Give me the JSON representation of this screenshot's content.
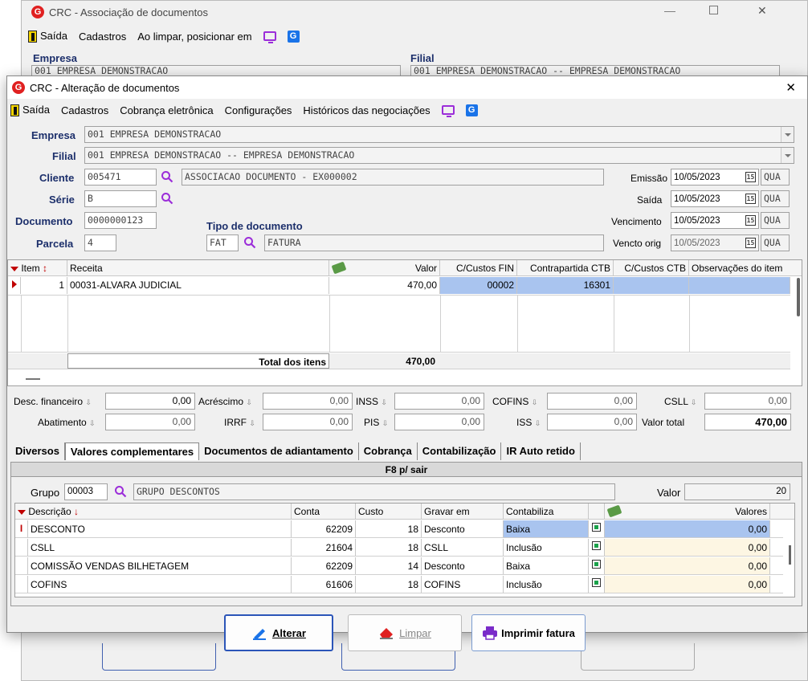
{
  "bg_window": {
    "title": "CRC - Associação de documentos",
    "menu": {
      "exit": "Saída",
      "cadastros": "Cadastros",
      "posicionar": "Ao limpar, posicionar em"
    },
    "empresa_label": "Empresa",
    "filial_label": "Filial",
    "empresa_value": "001 EMPRESA DEMONSTRACAO",
    "filial_value": "001 EMPRESA DEMONSTRACAO -- EMPRESA DEMONSTRACAO"
  },
  "window": {
    "title": "CRC - Alteração de documentos",
    "close": "✕",
    "menu": {
      "exit": "Saída",
      "cadastros": "Cadastros",
      "cobranca": "Cobrança eletrônica",
      "config": "Configurações",
      "historicos": "Históricos das negociações"
    }
  },
  "form": {
    "empresa_label": "Empresa",
    "empresa_value": "001 EMPRESA DEMONSTRACAO",
    "filial_label": "Filial",
    "filial_value": "001 EMPRESA DEMONSTRACAO -- EMPRESA DEMONSTRACAO",
    "cliente_label": "Cliente",
    "cliente_code": "005471",
    "cliente_name": "ASSOCIACAO DOCUMENTO - EX000002",
    "serie_label": "Série",
    "serie_value": "B",
    "documento_label": "Documento",
    "documento_value": "0000000123",
    "parcela_label": "Parcela",
    "parcela_value": "4",
    "tipo_label": "Tipo de documento",
    "tipo_code": "FAT",
    "tipo_name": "FATURA"
  },
  "dates": {
    "emissao_label": "Emissão",
    "emissao": "10/05/2023",
    "emissao_day": "QUA",
    "saida_label": "Saída",
    "saida": "10/05/2023",
    "saida_day": "QUA",
    "venc_label": "Vencimento",
    "venc": "10/05/2023",
    "venc_day": "QUA",
    "vencorig_label": "Vencto orig",
    "vencorig": "10/05/2023",
    "vencorig_day": "QUA",
    "cal_glyph": "15"
  },
  "items_grid": {
    "headers": {
      "item": "Item",
      "receita": "Receita",
      "valor": "Valor",
      "ccfin": "C/Custos FIN",
      "contra": "Contrapartida CTB",
      "ccctb": "C/Custos CTB",
      "obs": "Observações do item"
    },
    "rows": [
      {
        "item": "1",
        "receita": "00031-ALVARA JUDICIAL",
        "valor": "470,00",
        "ccfin": "00002",
        "contra": "16301",
        "ccctb": "",
        "obs": ""
      }
    ],
    "total_label": "Total dos itens",
    "total_value": "470,00"
  },
  "totals": {
    "desc_label": "Desc. financeiro",
    "desc": "0,00",
    "acres_label": "Acréscimo",
    "acres": "0,00",
    "inss_label": "INSS",
    "inss": "0,00",
    "cofins_label": "COFINS",
    "cofins": "0,00",
    "csll_label": "CSLL",
    "csll": "0,00",
    "abat_label": "Abatimento",
    "abat": "0,00",
    "irrf_label": "IRRF",
    "irrf": "0,00",
    "pis_label": "PIS",
    "pis": "0,00",
    "iss_label": "ISS",
    "iss": "0,00",
    "valortotal_label": "Valor total",
    "valortotal": "470,00"
  },
  "tabs": [
    "Diversos",
    "Valores complementares",
    "Documentos de adiantamento",
    "Cobrança",
    "Contabilização",
    "IR Auto retido"
  ],
  "complementares": {
    "banner": "F8 p/ sair",
    "grupo_label": "Grupo",
    "grupo_code": "00003",
    "grupo_name": "GRUPO DESCONTOS",
    "valor_label": "Valor",
    "valor": "20",
    "headers": {
      "descricao": "Descrição",
      "conta": "Conta",
      "custo": "Custo",
      "gravar": "Gravar em",
      "contabiliza": "Contabiliza",
      "valores": "Valores"
    },
    "rows": [
      {
        "descricao": "DESCONTO",
        "conta": "62209",
        "custo": "18",
        "gravar": "Desconto",
        "contabiliza": "Baixa",
        "valores": "0,00"
      },
      {
        "descricao": "CSLL",
        "conta": "21604",
        "custo": "18",
        "gravar": "CSLL",
        "contabiliza": "Inclusão",
        "valores": "0,00"
      },
      {
        "descricao": "COMISSÃO VENDAS BILHETAGEM",
        "conta": "62209",
        "custo": "14",
        "gravar": "Desconto",
        "contabiliza": "Baixa",
        "valores": "0,00"
      },
      {
        "descricao": "COFINS",
        "conta": "61606",
        "custo": "18",
        "gravar": "COFINS",
        "contabiliza": "Inclusão",
        "valores": "0,00"
      }
    ]
  },
  "buttons": {
    "alterar": "Alterar",
    "limpar": "Limpar",
    "imprimir": "Imprimir fatura"
  },
  "colors": {
    "accent": "#1c2f6b",
    "selection": "#a9c4ef",
    "brand": "#e02020"
  }
}
